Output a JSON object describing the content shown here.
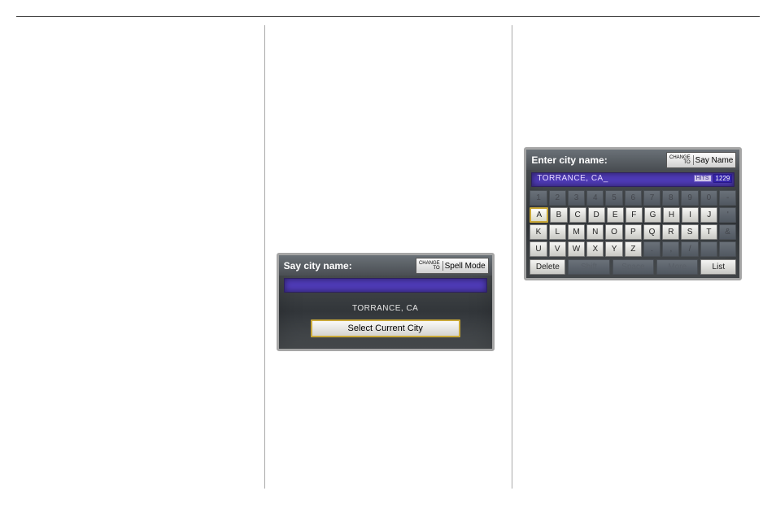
{
  "col2": {
    "device": {
      "title": "Say city name:",
      "changeTo": {
        "line1": "CHANGE",
        "line2": "TO",
        "target": "Spell Mode"
      },
      "inputText": "",
      "currentCityLine": "TORRANCE, CA",
      "selectBtn": "Select Current City"
    }
  },
  "col3": {
    "device": {
      "title": "Enter city name:",
      "changeTo": {
        "line1": "CHANGE",
        "line2": "TO",
        "target": "Say Name"
      },
      "inputText": "TORRANCE, CA_",
      "hitsLabel": "HITS",
      "hitsValue": "1229",
      "rowDigits": [
        "1",
        "2",
        "3",
        "4",
        "5",
        "6",
        "7",
        "8",
        "9",
        "0",
        "-"
      ],
      "rowA": [
        "A",
        "B",
        "C",
        "D",
        "E",
        "F",
        "G",
        "H",
        "I",
        "J",
        "'"
      ],
      "rowK": [
        "K",
        "L",
        "M",
        "N",
        "O",
        "P",
        "Q",
        "R",
        "S",
        "T",
        "&"
      ],
      "rowU": [
        "U",
        "V",
        "W",
        "X",
        "Y",
        "Z",
        ".",
        ",",
        "/",
        "",
        ""
      ],
      "rowUDimFrom": 6,
      "bottom": {
        "del": "Delete",
        "shift": "Shift",
        "space": "Space",
        "more": "More",
        "list": "List"
      }
    }
  }
}
